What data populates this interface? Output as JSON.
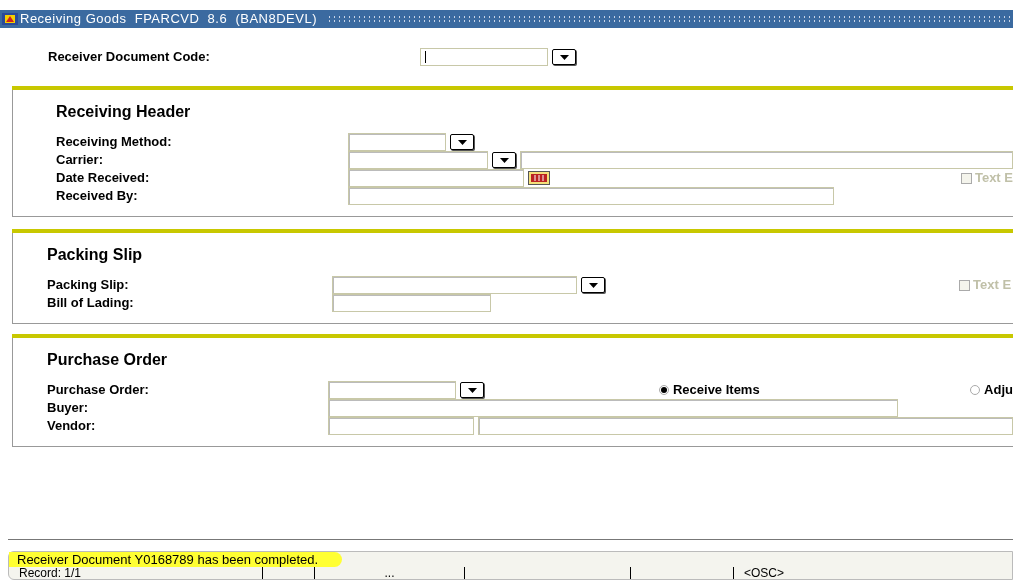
{
  "window": {
    "title": "Receiving Goods  FPARCVD  8.6  (BAN8DEVL)"
  },
  "key_block": {
    "label": "Receiver Document Code:"
  },
  "sections": [
    {
      "title": "Receiving Header",
      "rows": [
        {
          "label": "Receiving Method:",
          "kind": "lov-short"
        },
        {
          "label": "Carrier:",
          "kind": "lov-with-description"
        },
        {
          "label": "Date Received:",
          "kind": "date",
          "checkbox": {
            "label": "Text E",
            "checked": false
          }
        },
        {
          "label": "Received By:",
          "kind": "long-text"
        }
      ]
    },
    {
      "title": "Packing Slip",
      "rows": [
        {
          "label": "Packing Slip:",
          "kind": "lov-medium",
          "checkbox": {
            "label": "Text E",
            "checked": false
          }
        },
        {
          "label": "Bill of Lading:",
          "kind": "short-text"
        }
      ]
    },
    {
      "title": "Purchase Order",
      "rows": [
        {
          "label": "Purchase Order:",
          "kind": "lov-po",
          "radios": [
            {
              "label": "Receive Items",
              "selected": true
            },
            {
              "label": "Adju",
              "selected": false
            }
          ]
        },
        {
          "label": "Buyer:",
          "kind": "buyer-text"
        },
        {
          "label": "Vendor:",
          "kind": "code-with-description"
        }
      ]
    }
  ],
  "status_bar": {
    "message": "Receiver Document Y0168789 has been completed.",
    "record": "Record: 1/1",
    "segment_3": "...",
    "mode": "<OSC>"
  }
}
